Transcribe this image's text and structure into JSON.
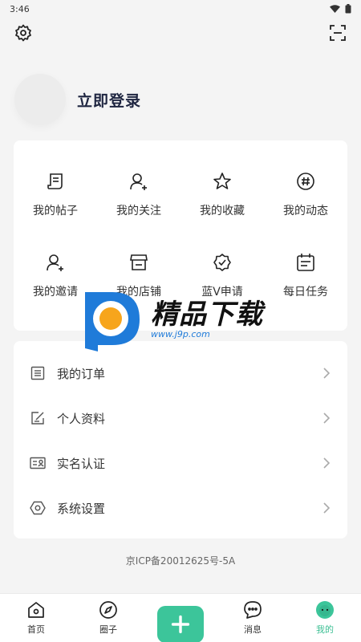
{
  "status_bar": {
    "time": "3:46"
  },
  "header": {
    "login_text": "立即登录"
  },
  "grid": [
    {
      "label": "我的帖子",
      "icon": "post-icon"
    },
    {
      "label": "我的关注",
      "icon": "follow-icon"
    },
    {
      "label": "我的收藏",
      "icon": "star-icon"
    },
    {
      "label": "我的动态",
      "icon": "hashtag-icon"
    },
    {
      "label": "我的邀请",
      "icon": "invite-icon"
    },
    {
      "label": "我的店铺",
      "icon": "store-icon"
    },
    {
      "label": "蓝V申请",
      "icon": "verified-badge-icon"
    },
    {
      "label": "每日任务",
      "icon": "calendar-icon"
    }
  ],
  "list": [
    {
      "label": "我的订单",
      "icon": "order-icon"
    },
    {
      "label": "个人资料",
      "icon": "edit-profile-icon"
    },
    {
      "label": "实名认证",
      "icon": "id-card-icon"
    },
    {
      "label": "系统设置",
      "icon": "hexagon-settings-icon"
    }
  ],
  "footer": {
    "icp": "京ICP备20012625号-5A"
  },
  "tabs": [
    {
      "label": "首页",
      "icon": "home-icon"
    },
    {
      "label": "圈子",
      "icon": "compass-icon"
    },
    {
      "label": "",
      "icon": "add-icon"
    },
    {
      "label": "消息",
      "icon": "message-icon"
    },
    {
      "label": "我的",
      "icon": "profile-face-icon"
    }
  ],
  "watermark": {
    "title": "精品下载",
    "url": "www.j9p.com"
  },
  "colors": {
    "accent": "#3cc59a",
    "background": "#f4f4f4",
    "title_text": "#1e2540"
  }
}
